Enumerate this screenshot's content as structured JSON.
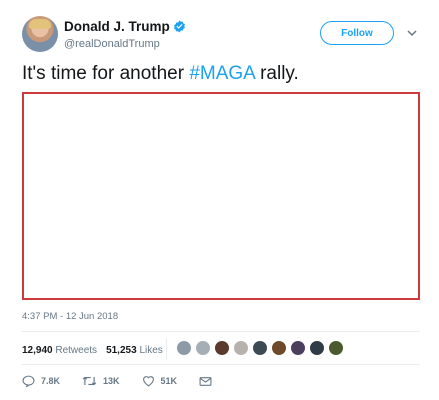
{
  "author": {
    "display_name": "Donald J. Trump",
    "handle": "@realDonaldTrump",
    "verified": true
  },
  "follow_label": "Follow",
  "tweet": {
    "text_prefix": "It's time for another ",
    "hashtag": "#MAGA",
    "text_suffix": " rally."
  },
  "timestamp": "4:37 PM - 12 Jun 2018",
  "stats": {
    "retweets_count": "12,940",
    "retweets_label": "Retweets",
    "likes_count": "51,253",
    "likes_label": "Likes"
  },
  "liker_avatars": 9,
  "actions": {
    "reply_count": "7.8K",
    "retweet_count": "13K",
    "like_count": "51K"
  },
  "colors": {
    "accent": "#1da1f2",
    "text": "#14171a",
    "secondary": "#657786",
    "media_border": "#cc3b3b"
  },
  "icons": [
    "verified-badge-icon",
    "chevron-down-icon",
    "reply-icon",
    "retweet-icon",
    "heart-icon",
    "envelope-icon"
  ]
}
